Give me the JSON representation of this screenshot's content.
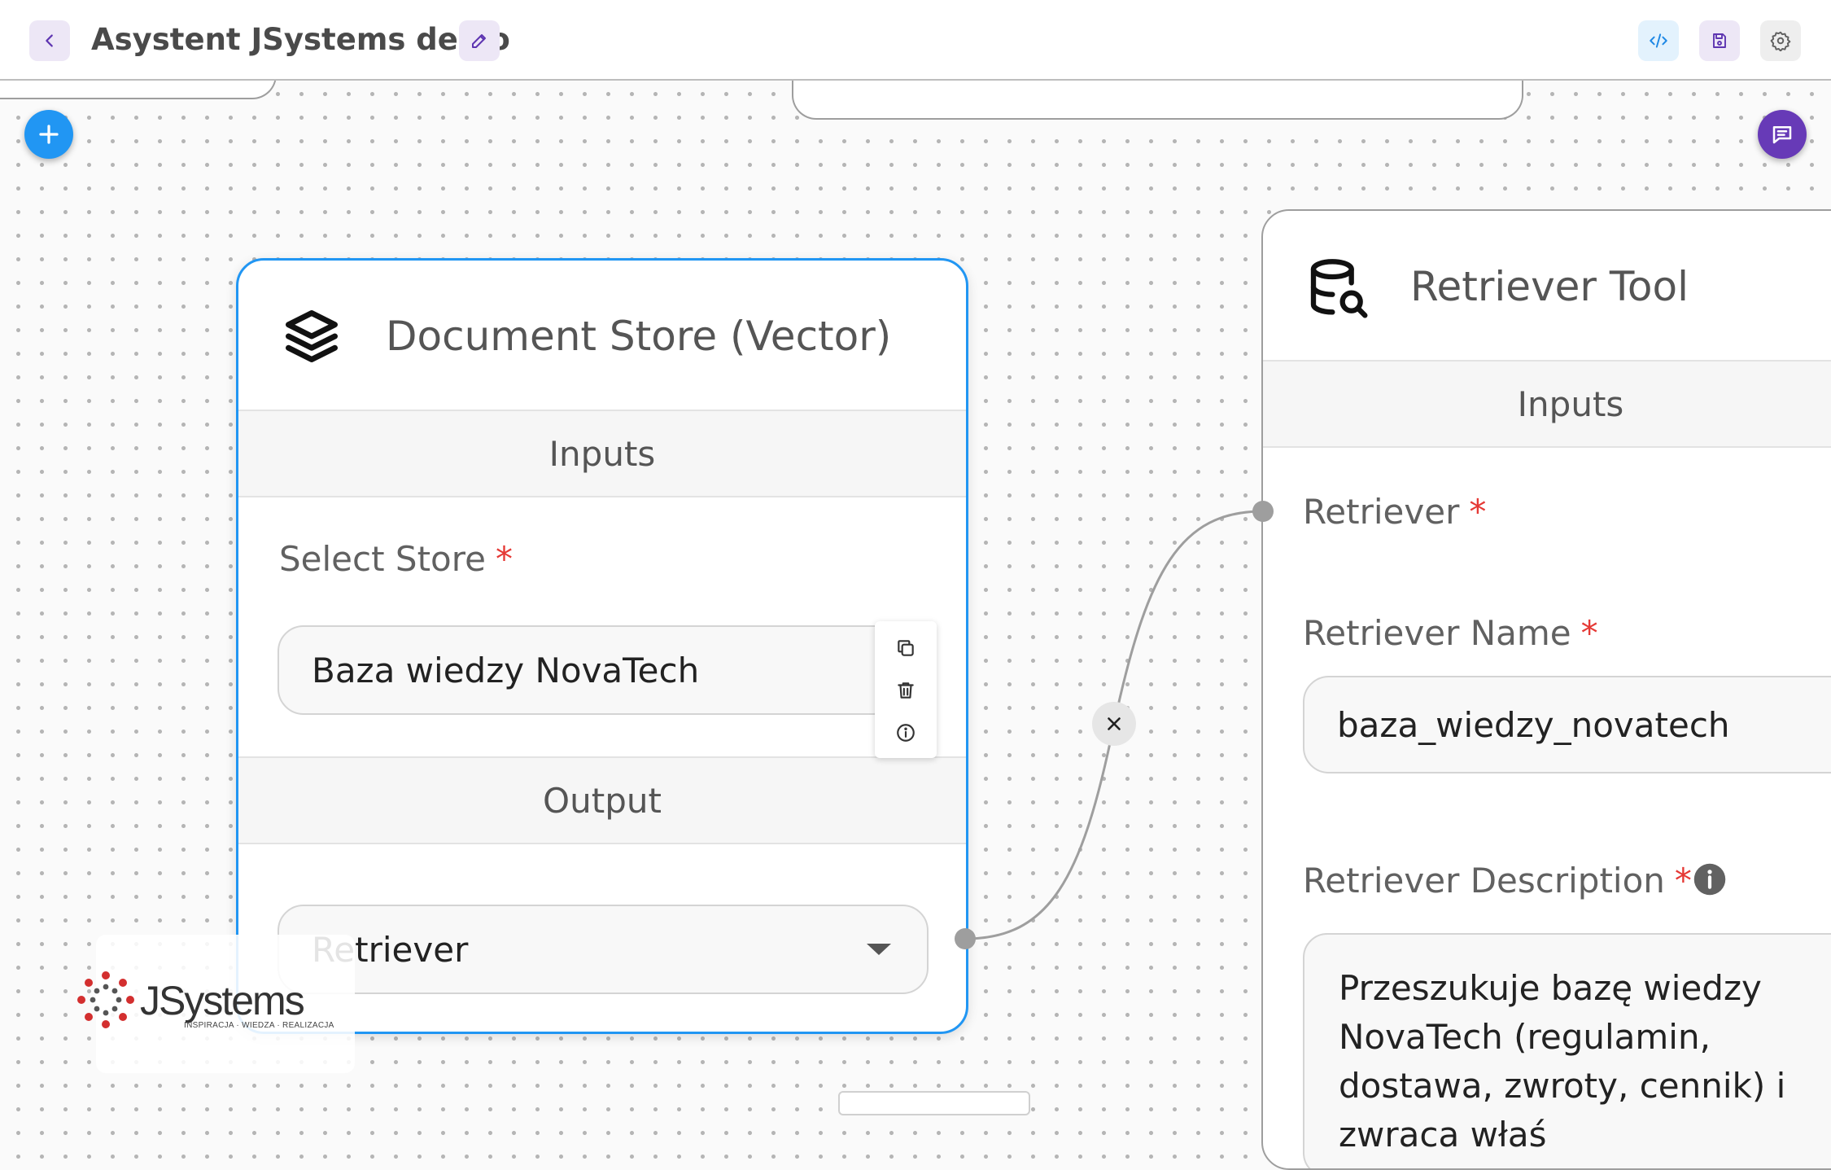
{
  "header": {
    "title": "Asystent JSystems demo"
  },
  "document_store_node": {
    "title": "Document Store (Vector)",
    "inputs_label": "Inputs",
    "select_store_label": "Select Store",
    "required_mark": "*",
    "select_store_value": "Baza wiedzy NovaTech",
    "output_label": "Output",
    "output_value": "Retriever"
  },
  "retriever_tool_node": {
    "title": "Retriever Tool",
    "inputs_label": "Inputs",
    "retriever_label": "Retriever",
    "retriever_name_label": "Retriever Name",
    "retriever_name_value": "baza_wiedzy_novatech",
    "retriever_description_label": "Retriever Description",
    "retriever_description_value": "Przeszukuje bazę wiedzy NovaTech (regulamin, dostawa, zwroty, cennik) i zwraca właś",
    "required_mark": "*"
  },
  "logo": {
    "name": "JSystems",
    "tagline": "INSPIRACJA · WIEDZA · REALIZACJA"
  },
  "colors": {
    "accent_blue": "#2196f3",
    "accent_purple": "#673ab7",
    "required_red": "#e53935"
  }
}
